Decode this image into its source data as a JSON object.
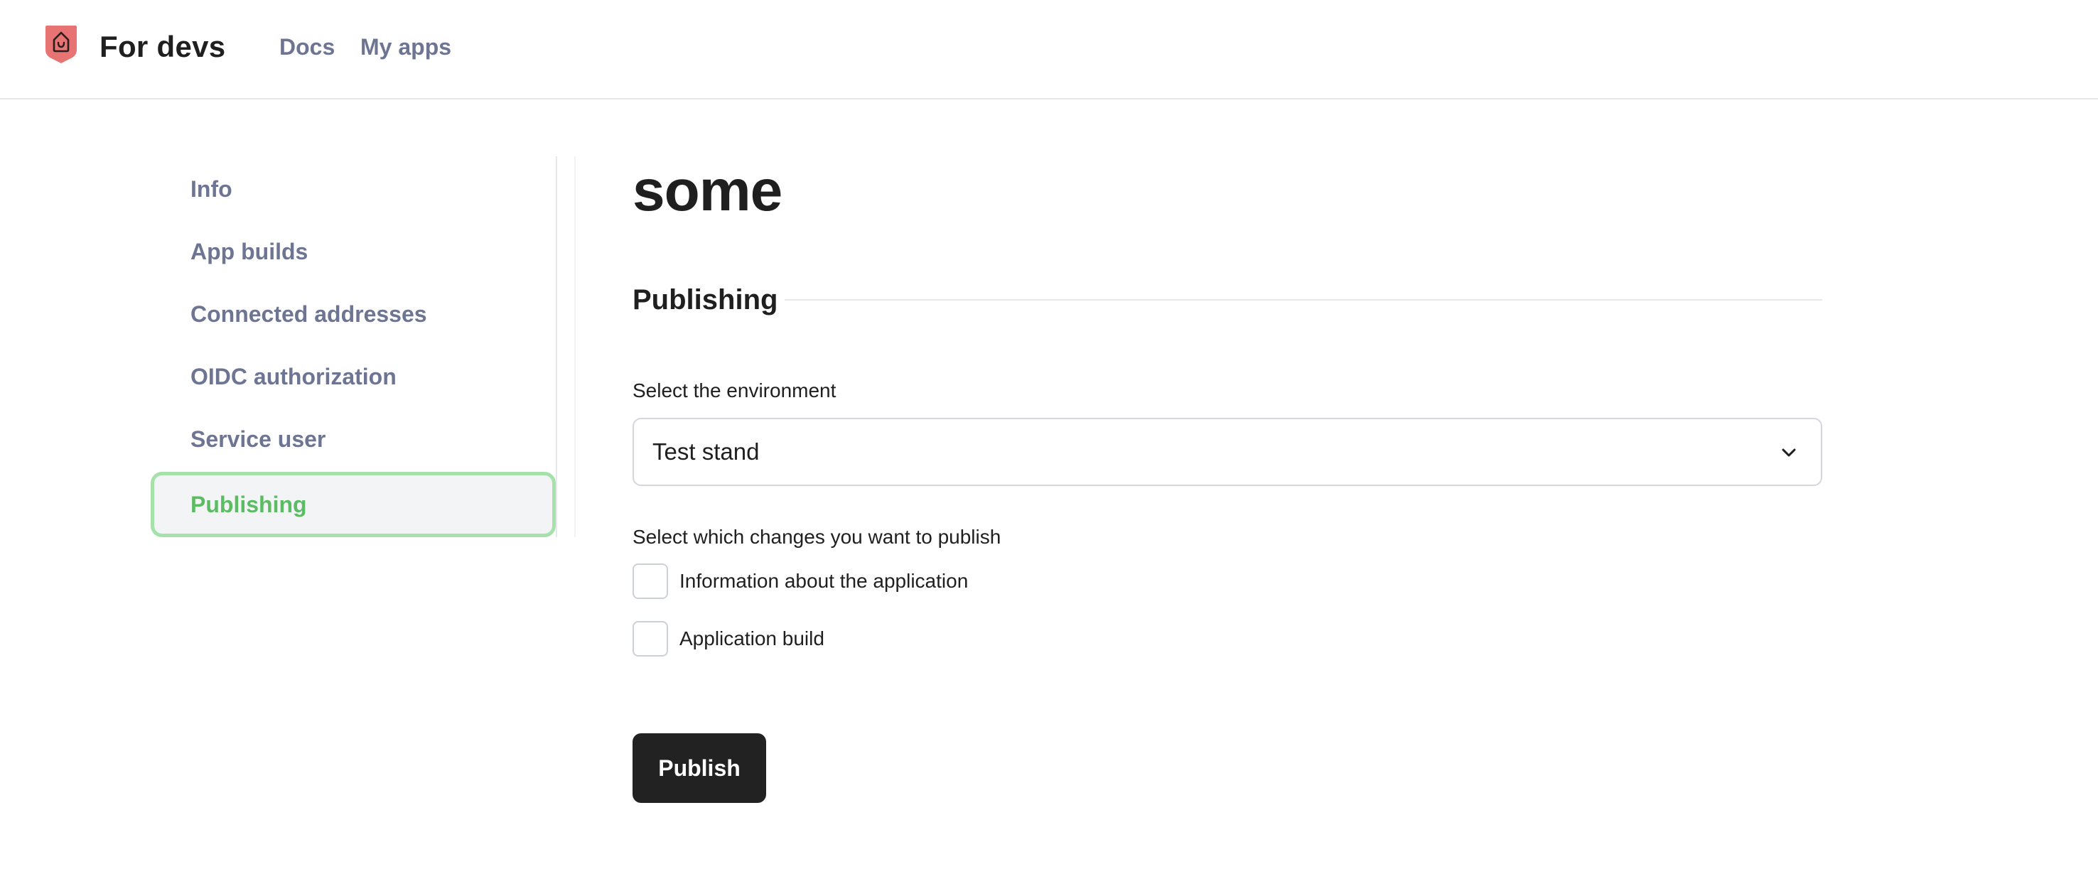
{
  "header": {
    "brand": "For devs",
    "nav": [
      "Docs",
      "My apps"
    ]
  },
  "sidebar": {
    "items": [
      {
        "label": "Info",
        "active": false
      },
      {
        "label": "App builds",
        "active": false
      },
      {
        "label": "Connected addresses",
        "active": false
      },
      {
        "label": "OIDC authorization",
        "active": false
      },
      {
        "label": "Service user",
        "active": false
      },
      {
        "label": "Publishing",
        "active": true
      }
    ]
  },
  "main": {
    "title": "some",
    "section_title": "Publishing",
    "environment": {
      "label": "Select the environment",
      "selected": "Test stand"
    },
    "changes": {
      "label": "Select which changes you want to publish",
      "options": [
        {
          "label": "Information about the application",
          "checked": false
        },
        {
          "label": "Application build",
          "checked": false
        }
      ]
    },
    "publish_button": "Publish"
  },
  "colors": {
    "logo": "#e87373",
    "nav_text": "#6e7593",
    "active_text": "#5cbc63",
    "active_border": "#a6e0aa",
    "button_bg": "#222222"
  },
  "icons": {
    "logo": "house-shield-icon",
    "select": "chevron-down-icon"
  }
}
